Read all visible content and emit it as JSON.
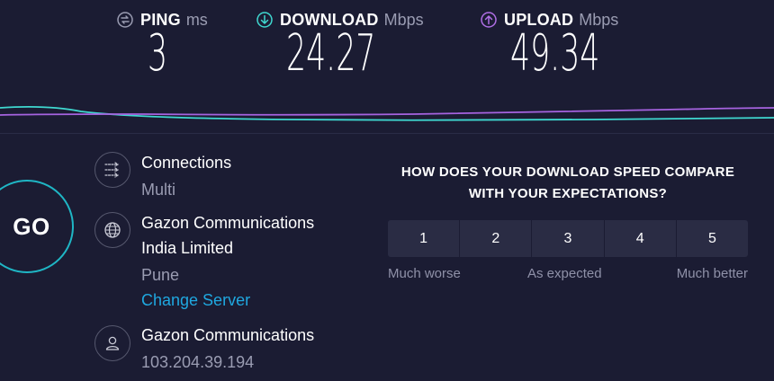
{
  "stats": {
    "ping": {
      "label": "PING",
      "unit": "ms",
      "value": "3",
      "color": "#9a9cb2"
    },
    "download": {
      "label": "DOWNLOAD",
      "unit": "Mbps",
      "value": "24.27",
      "color": "#3fd8d0"
    },
    "upload": {
      "label": "UPLOAD",
      "unit": "Mbps",
      "value": "49.34",
      "color": "#b06fe6"
    }
  },
  "go_button": {
    "label": "GO"
  },
  "connections": {
    "title": "Connections",
    "value": "Multi"
  },
  "server": {
    "name_line1": "Gazon Communications",
    "name_line2": "India Limited",
    "location": "Pune",
    "change_label": "Change Server"
  },
  "provider": {
    "name": "Gazon Communications",
    "ip": "103.204.39.194"
  },
  "survey": {
    "question_line1": "HOW DOES YOUR DOWNLOAD SPEED COMPARE",
    "question_line2": "WITH YOUR EXPECTATIONS?",
    "options": [
      "1",
      "2",
      "3",
      "4",
      "5"
    ],
    "low_label": "Much worse",
    "mid_label": "As expected",
    "high_label": "Much better"
  },
  "icons": {
    "ping": "ping-icon",
    "download": "download-arrow-icon",
    "upload": "upload-arrow-icon",
    "connections": "connections-icon",
    "globe": "globe-icon",
    "user": "user-icon"
  },
  "colors": {
    "background": "#1b1c33",
    "accent_cyan": "#1fb6c5",
    "link_blue": "#1fa8e0"
  }
}
